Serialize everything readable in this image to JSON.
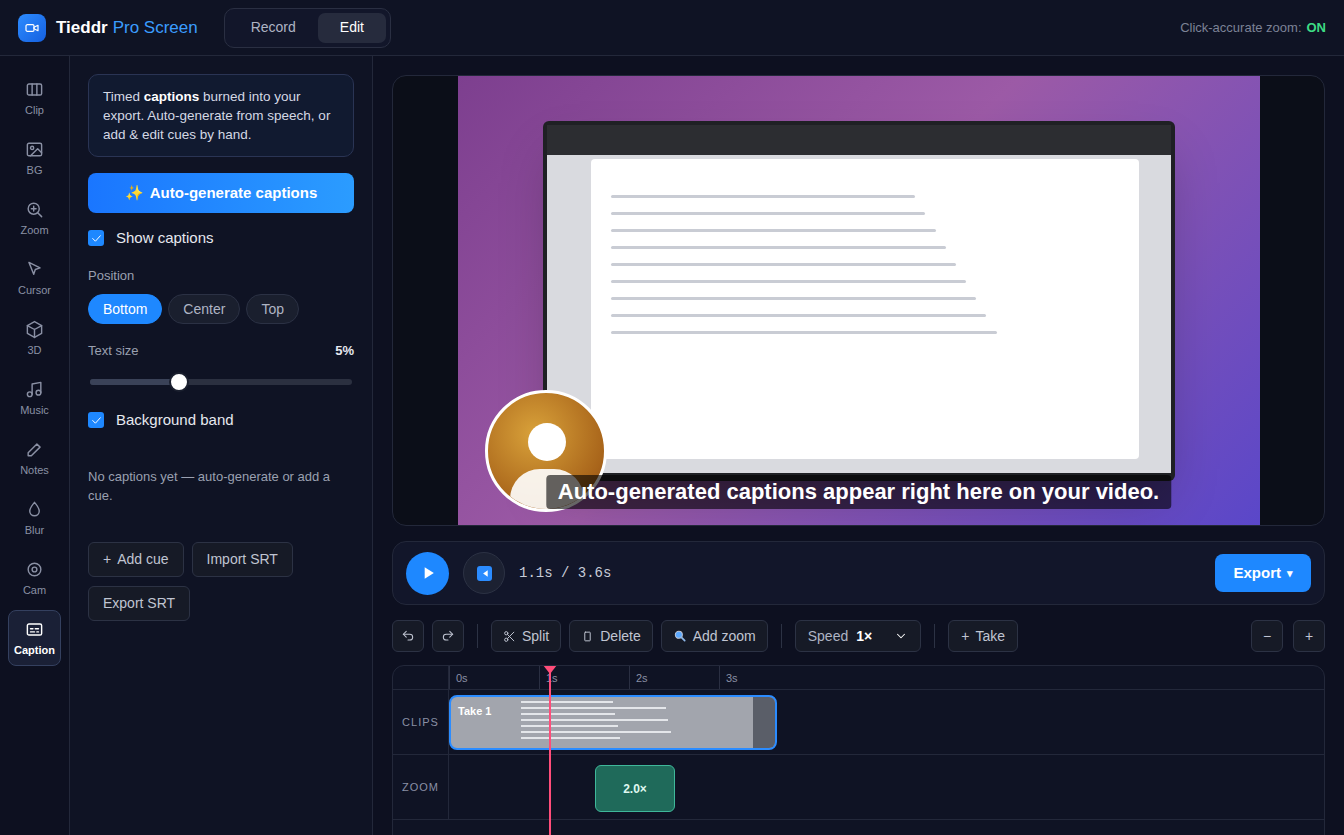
{
  "app": {
    "name": "Tieddr",
    "suffix": "Pro Screen"
  },
  "mode_tabs": [
    {
      "label": "Record",
      "selected": false
    },
    {
      "label": "Edit",
      "selected": true
    }
  ],
  "zoom_status": {
    "label": "Click-accurate zoom:",
    "value": "ON",
    "on": true
  },
  "rail": [
    {
      "label": "Clip",
      "selected": false
    },
    {
      "label": "BG",
      "selected": false
    },
    {
      "label": "Zoom",
      "selected": false
    },
    {
      "label": "Cursor",
      "selected": false
    },
    {
      "label": "3D",
      "selected": false
    },
    {
      "label": "Music",
      "selected": false
    },
    {
      "label": "Notes",
      "selected": false
    },
    {
      "label": "Blur",
      "selected": false
    },
    {
      "label": "Cam",
      "selected": false
    },
    {
      "label": "Caption",
      "selected": true
    }
  ],
  "caption_panel": {
    "intro": [
      {
        "text": "Timed ",
        "bold": false
      },
      {
        "text": "captions",
        "bold": true
      },
      {
        "text": " burned into your export. Auto-generate from speech, or add & edit cues by hand.",
        "bold": false
      }
    ],
    "auto_generate": {
      "icon": "✨",
      "label": "Auto-generate captions"
    },
    "show_captions": {
      "label": "Show captions",
      "checked": true
    },
    "position": {
      "label": "Position",
      "options": [
        {
          "label": "Bottom",
          "selected": true
        },
        {
          "label": "Center",
          "selected": false
        },
        {
          "label": "Top",
          "selected": false
        }
      ]
    },
    "text_size": {
      "label": "Text size",
      "reading": "5%",
      "level": 0.34
    },
    "background_band": {
      "label": "Background band",
      "checked": true
    },
    "empty_message": "No captions yet — auto-generate or add a cue.",
    "actions": [
      {
        "icon": "+",
        "label": "Add cue"
      },
      {
        "label": "Import SRT"
      },
      {
        "label": "Export SRT"
      }
    ]
  },
  "preview": {
    "caption": "Auto-generated captions appear right here on your video."
  },
  "player": {
    "time": "1.1s / 3.6s",
    "export": {
      "label": "Export",
      "icon": "▾"
    }
  },
  "toolbar": {
    "split": "Split",
    "delete": "Delete",
    "add_zoom": "Add zoom",
    "speed": {
      "label": "Speed",
      "value": "1×"
    },
    "take": {
      "icon": "+",
      "label": "Take"
    },
    "zoom_out": "−",
    "zoom_in": "+"
  },
  "timeline": {
    "ticks": [
      "0s",
      "1s",
      "2s",
      "3s"
    ],
    "tracks": [
      {
        "label": "CLIPS"
      },
      {
        "label": "ZOOM"
      }
    ],
    "clips": [
      {
        "label": "Take 1",
        "selected": true
      }
    ],
    "zoom_segments": [
      {
        "label": "2.0×"
      }
    ]
  }
}
